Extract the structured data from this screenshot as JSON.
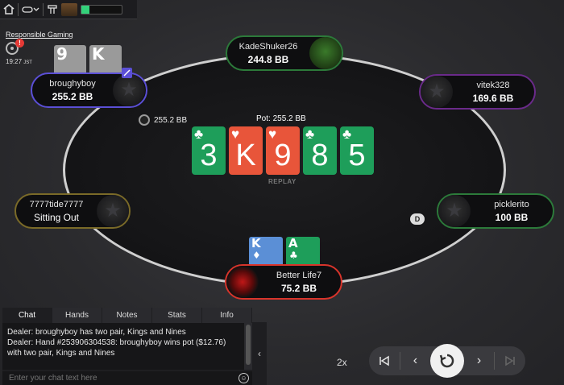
{
  "toolbar": {
    "home_icon": "home-icon",
    "view_icon": "view-toggle-icon",
    "menu_icon": "menu-icon",
    "meter_level": 0.2
  },
  "lobby": {
    "responsible_gaming": "Responsible Gaming",
    "alert_count": "!",
    "time": "19:27",
    "time_zone": "JST"
  },
  "table": {
    "pot_label": "Pot: 255.2 BB",
    "replay_label": "REPLAY",
    "dealer_label": "D",
    "bet_amount": "255.2 BB",
    "board": [
      {
        "rank": "3",
        "suit": "♣",
        "color": "#1e9e5a"
      },
      {
        "rank": "K",
        "suit": "♥",
        "color": "#e8553a"
      },
      {
        "rank": "9",
        "suit": "♥",
        "color": "#e8553a"
      },
      {
        "rank": "8",
        "suit": "♣",
        "color": "#1e9e5a"
      },
      {
        "rank": "5",
        "suit": "♣",
        "color": "#1e9e5a"
      }
    ]
  },
  "players": {
    "broughyboy": {
      "name": "broughyboy",
      "stack": "255.2 BB",
      "border": "#5b4fd6",
      "cards": [
        {
          "rank": "9",
          "suit": ""
        },
        {
          "rank": "K",
          "suit": ""
        }
      ]
    },
    "kade": {
      "name": "KadeShuker26",
      "stack": "244.8 BB",
      "border": "#2c7a3a"
    },
    "vitek": {
      "name": "vitek328",
      "stack": "169.6 BB",
      "border": "#6a2a8a"
    },
    "tide": {
      "name": "7777tide7777",
      "stack": "Sitting Out",
      "border": "#7a6a28"
    },
    "pickle": {
      "name": "picklerito",
      "stack": "100 BB",
      "border": "#2c7a3a"
    },
    "hero": {
      "name": "Better Life7",
      "stack": "75.2 BB",
      "border": "#d9342b",
      "cards": [
        {
          "rank": "K",
          "suit": "♦",
          "color": "#5b8fd6"
        },
        {
          "rank": "A",
          "suit": "♣",
          "color": "#1e9e5a"
        }
      ]
    }
  },
  "chat": {
    "tabs": [
      "Chat",
      "Hands",
      "Notes",
      "Stats",
      "Info"
    ],
    "messages": [
      "Dealer: broughyboy has two pair, Kings and Nines",
      "Dealer: Hand #253906304538: broughyboy wins pot ($12.76) with two pair, Kings and Nines"
    ],
    "input_placeholder": "Enter your chat text here"
  },
  "replay_controls": {
    "speed": "2x"
  }
}
